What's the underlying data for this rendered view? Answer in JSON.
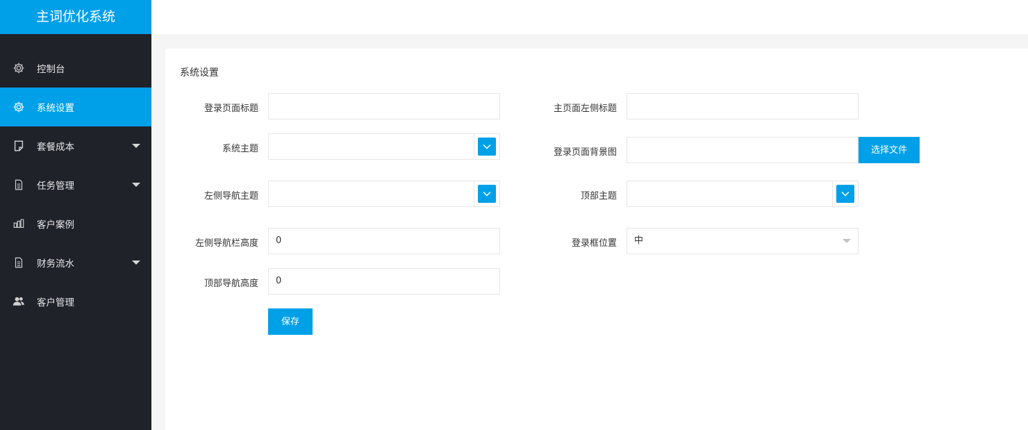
{
  "brand": "主词优化系统",
  "nav": [
    {
      "label": "控制台",
      "icon": "gear-icon",
      "active": false,
      "caret": false
    },
    {
      "label": "系统设置",
      "icon": "gear-icon",
      "active": true,
      "caret": false
    },
    {
      "label": "套餐成本",
      "icon": "note-icon",
      "active": false,
      "caret": true
    },
    {
      "label": "任务管理",
      "icon": "document-icon",
      "active": false,
      "caret": true
    },
    {
      "label": "客户案例",
      "icon": "case-icon",
      "active": false,
      "caret": false
    },
    {
      "label": "财务流水",
      "icon": "document-icon",
      "active": false,
      "caret": true
    },
    {
      "label": "客户管理",
      "icon": "users-icon",
      "active": false,
      "caret": false
    }
  ],
  "panel": {
    "title": "系统设置",
    "fields": {
      "login_title": {
        "label": "登录页面标题",
        "value": ""
      },
      "left_title": {
        "label": "主页面左侧标题",
        "value": ""
      },
      "system_theme": {
        "label": "系统主题",
        "value": ""
      },
      "login_bg": {
        "label": "登录页面背景图",
        "value": "",
        "button": "选择文件"
      },
      "left_nav_theme": {
        "label": "左侧导航主题",
        "value": ""
      },
      "top_theme": {
        "label": "顶部主题",
        "value": ""
      },
      "left_nav_height": {
        "label": "左侧导航栏高度",
        "value": "0"
      },
      "login_box_pos": {
        "label": "登录框位置",
        "value": "中"
      },
      "top_nav_height": {
        "label": "顶部导航高度",
        "value": "0"
      }
    },
    "save_label": "保存"
  },
  "colors": {
    "accent": "#00a0e9",
    "sidebar_bg": "#20222a"
  }
}
